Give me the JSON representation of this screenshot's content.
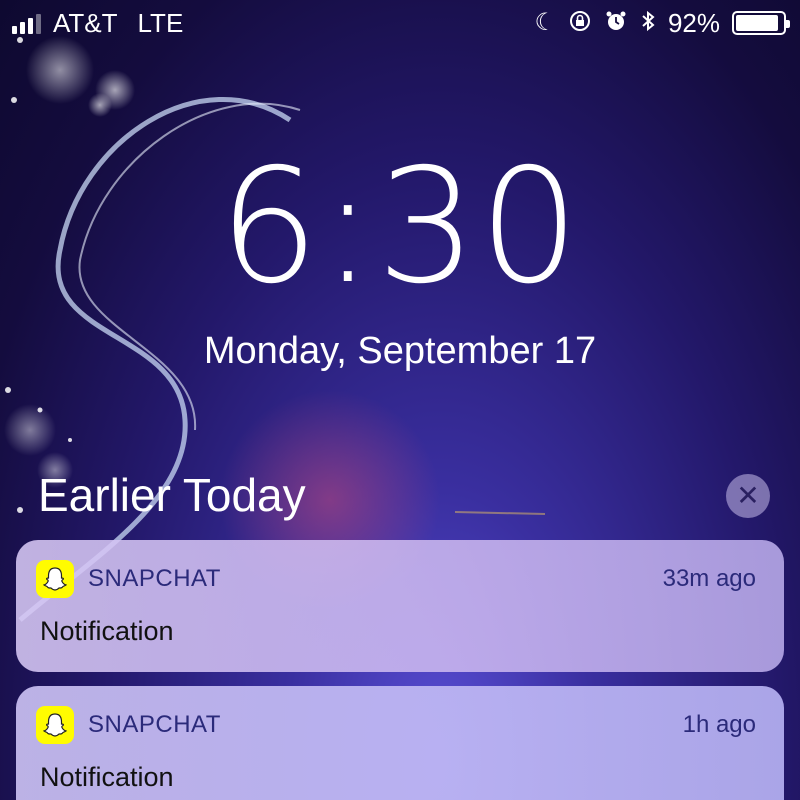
{
  "status_bar": {
    "carrier": "AT&T",
    "network": "LTE",
    "battery_percent": "92%",
    "battery_level": 0.92,
    "icons": [
      "do-not-disturb-moon-icon",
      "rotation-lock-icon",
      "alarm-icon",
      "bluetooth-icon"
    ]
  },
  "lock_screen": {
    "time": "6:30",
    "date": "Monday, September 17"
  },
  "notifications_section": {
    "title": "Earlier Today",
    "clear_icon": "close-icon",
    "items": [
      {
        "app": "SNAPCHAT",
        "time": "33m ago",
        "body": "Notification",
        "icon": "snapchat-ghost-icon"
      },
      {
        "app": "SNAPCHAT",
        "time": "1h ago",
        "body": "Notification",
        "icon": "snapchat-ghost-icon"
      }
    ]
  },
  "colors": {
    "snapchat_yellow": "#fffc00",
    "notification_text_accent": "#2b2a7a"
  }
}
